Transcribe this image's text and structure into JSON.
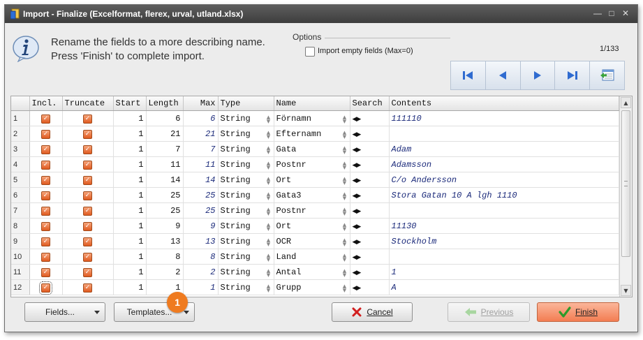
{
  "window": {
    "title": "Import - Finalize  (Excelformat, flerex, urval, utland.xlsx)"
  },
  "info": {
    "line1": "Rename the fields to a more describing name.",
    "line2": "Press 'Finish' to complete import."
  },
  "options": {
    "label": "Options",
    "import_empty_label": "Import empty fields (Max=0)",
    "import_empty_checked": false
  },
  "page_counter": "1/133",
  "grid": {
    "columns": [
      "",
      "Incl.",
      "Truncate",
      "Start",
      "Length",
      "Max",
      "Type",
      "Name",
      "Search",
      "Contents"
    ],
    "rows": [
      {
        "n": "1",
        "start": "1",
        "length": "6",
        "max": "6",
        "type": "String",
        "name": "Förnamn",
        "contents": "111110"
      },
      {
        "n": "2",
        "start": "1",
        "length": "21",
        "max": "21",
        "type": "String",
        "name": "Efternamn",
        "contents": ""
      },
      {
        "n": "3",
        "start": "1",
        "length": "7",
        "max": "7",
        "type": "String",
        "name": "Gata",
        "contents": "Adam"
      },
      {
        "n": "4",
        "start": "1",
        "length": "11",
        "max": "11",
        "type": "String",
        "name": "Postnr",
        "contents": "Adamsson"
      },
      {
        "n": "5",
        "start": "1",
        "length": "14",
        "max": "14",
        "type": "String",
        "name": "Ort",
        "contents": "C/o Andersson"
      },
      {
        "n": "6",
        "start": "1",
        "length": "25",
        "max": "25",
        "type": "String",
        "name": "Gata3",
        "contents": "Stora Gatan 10 A lgh 1110"
      },
      {
        "n": "7",
        "start": "1",
        "length": "25",
        "max": "25",
        "type": "String",
        "name": "Postnr",
        "contents": ""
      },
      {
        "n": "8",
        "start": "1",
        "length": "9",
        "max": "9",
        "type": "String",
        "name": "Ort",
        "contents": "11130"
      },
      {
        "n": "9",
        "start": "1",
        "length": "13",
        "max": "13",
        "type": "String",
        "name": "OCR",
        "contents": "Stockholm"
      },
      {
        "n": "10",
        "start": "1",
        "length": "8",
        "max": "8",
        "type": "String",
        "name": "Land",
        "contents": ""
      },
      {
        "n": "11",
        "start": "1",
        "length": "2",
        "max": "2",
        "type": "String",
        "name": "Antal",
        "contents": "1"
      },
      {
        "n": "12",
        "start": "1",
        "length": "1",
        "max": "1",
        "type": "String",
        "name": "Grupp",
        "contents": "A"
      }
    ]
  },
  "buttons": {
    "fields": "Fields...",
    "templates": "Templates...",
    "cancel": "Cancel",
    "previous": "Previous",
    "finish": "Finish"
  },
  "callout": {
    "number": "1"
  },
  "colors": {
    "titlebar": "#4a4a4a",
    "checkbox": "#e8652a",
    "accent": "#f37d52",
    "contents_text": "#1b2a7a"
  },
  "icons": {
    "info": "info-icon",
    "first": "first-page-icon",
    "prev": "prev-page-icon",
    "next": "next-page-icon",
    "last": "last-page-icon",
    "export": "export-icon",
    "cancel": "red-x-icon",
    "previous": "green-left-arrow-icon",
    "finish": "green-check-icon"
  }
}
